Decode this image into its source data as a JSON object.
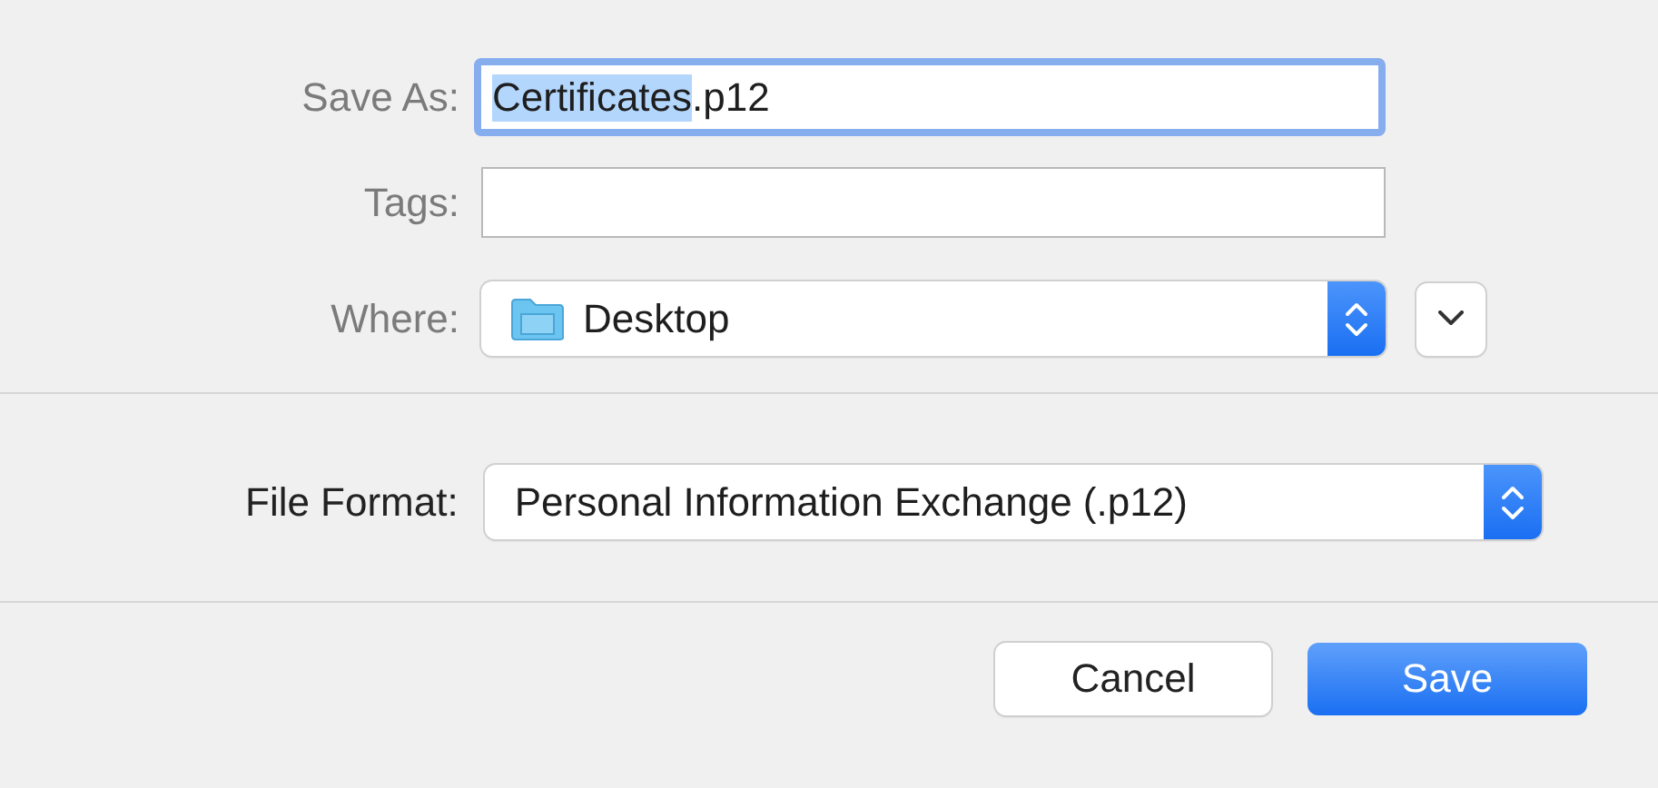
{
  "save_as": {
    "label": "Save As:",
    "focused": true,
    "value_parts": [
      {
        "text": "Certificates",
        "selected": true
      },
      {
        "text": ".p12",
        "selected": false
      }
    ]
  },
  "tags": {
    "label": "Tags:"
  },
  "where": {
    "label": "Where:",
    "value": "Desktop",
    "expanded": false
  },
  "file_format": {
    "label": "File Format:",
    "value": "Personal Information Exchange (.p12)"
  },
  "buttons": [
    {
      "label": "Cancel",
      "default": false
    },
    {
      "label": "Save",
      "default": true
    }
  ]
}
